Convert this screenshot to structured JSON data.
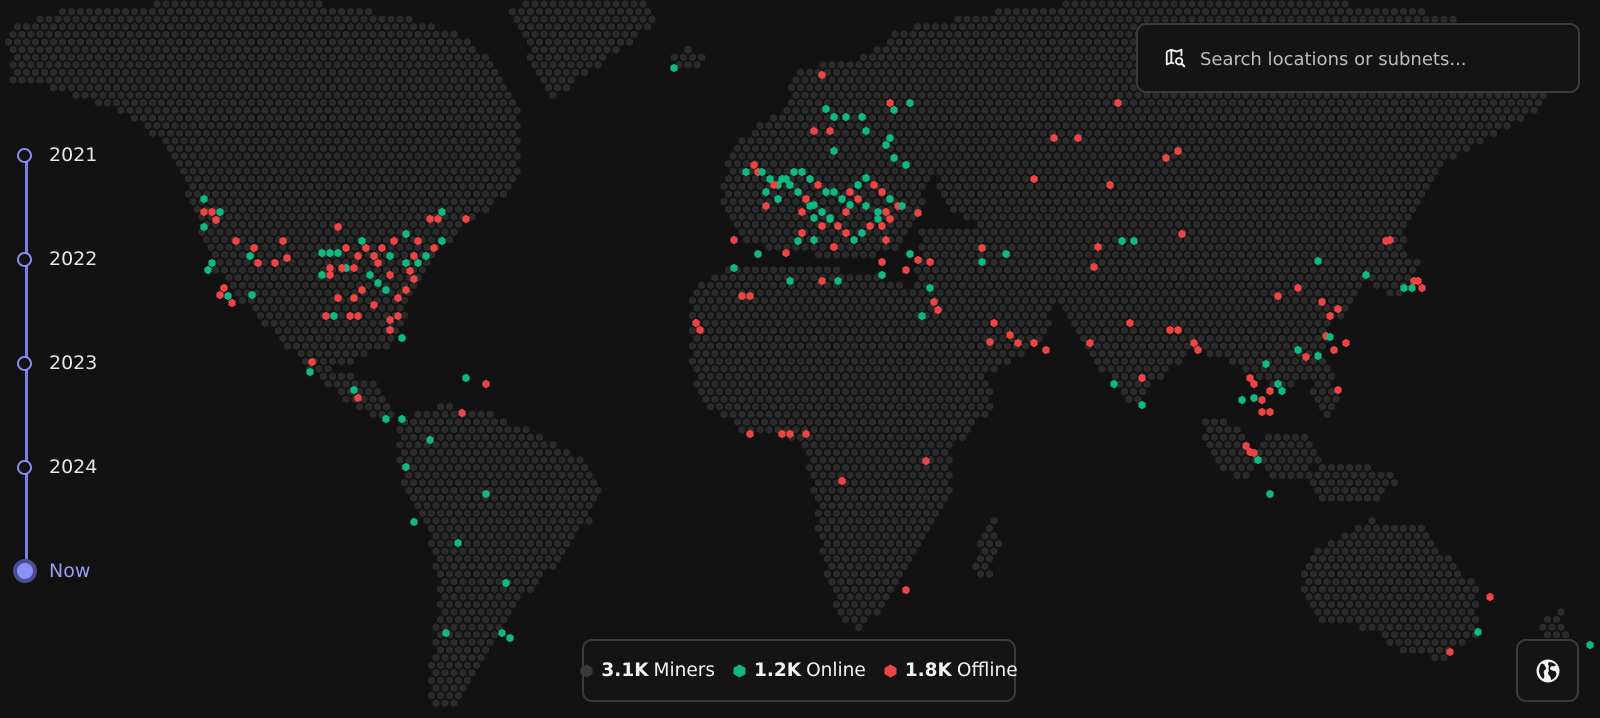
{
  "timeline": {
    "items": [
      {
        "label": "2021",
        "active": false
      },
      {
        "label": "2022",
        "active": false
      },
      {
        "label": "2023",
        "active": false
      },
      {
        "label": "2024",
        "active": false
      },
      {
        "label": "Now",
        "active": true
      }
    ]
  },
  "search": {
    "placeholder": "Search locations or subnets...",
    "icon": "map-search-icon"
  },
  "legend": {
    "miners": {
      "count": "3.1K",
      "label": "Miners",
      "color": "#3a3a3a"
    },
    "online": {
      "count": "1.2K",
      "label": "Online",
      "color": "#10b981"
    },
    "offline": {
      "count": "1.8K",
      "label": "Offline",
      "color": "#ef4444"
    }
  },
  "globe_button": {
    "icon": "globe-icon"
  },
  "map": {
    "colors": {
      "land": "#2b2b2b",
      "online": "#10b981",
      "offline": "#ef4444"
    }
  }
}
